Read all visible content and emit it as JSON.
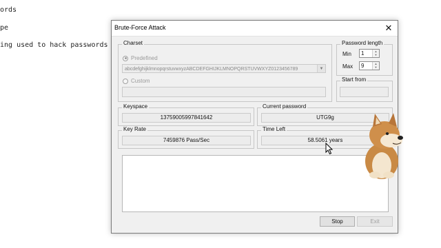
{
  "background": {
    "lines": [
      "ords",
      "pe",
      "ing used to hack passwords"
    ]
  },
  "dialog": {
    "title": "Brute-Force Attack",
    "close_label": "✕",
    "charset": {
      "group_label": "Charset",
      "predefined_label": "Predefined",
      "predefined_value": "abcdefghijklmnopqrstuvwxyzABCDEFGHIJKLMNOPQRSTUVWXYZ0123456789",
      "custom_label": "Custom",
      "custom_value": ""
    },
    "password_length": {
      "group_label": "Password length",
      "min_label": "Min",
      "min_value": "1",
      "max_label": "Max",
      "max_value": "9"
    },
    "start_from": {
      "group_label": "Start from",
      "value": ""
    },
    "keyspace": {
      "label": "Keyspace",
      "value": "13759005997841642"
    },
    "current_password": {
      "label": "Current password",
      "value": "UTG9g"
    },
    "key_rate": {
      "label": "Key Rate",
      "value": "7459876 Pass/Sec"
    },
    "time_left": {
      "label": "Time Left",
      "value": "58.5061 years"
    },
    "log_text": "",
    "buttons": {
      "stop": "Stop",
      "exit": "Exit"
    }
  },
  "icons": {
    "cursor": "arrow-cursor-icon",
    "dog": "shiba-dog-icon",
    "close": "close-icon"
  },
  "colors": {
    "dialog_bg": "#f0f0f0",
    "titlebar_bg": "#ffffff",
    "disabled_text": "#9a9a9a"
  }
}
